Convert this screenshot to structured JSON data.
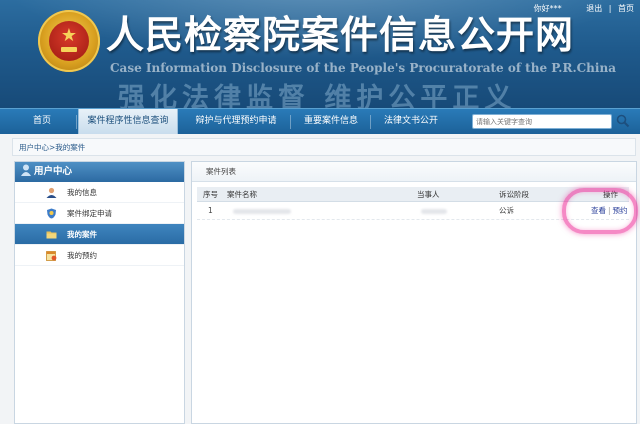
{
  "top_links": {
    "greeting": "你好***",
    "logout": "退出",
    "sep": "|",
    "home": "首页"
  },
  "site": {
    "title": "人民检察院案件信息公开网",
    "subtitle": "Case Information Disclosure of the People's Procuratorate of the P.R.China",
    "slogan": "强化法律监督 维护公平正义"
  },
  "nav": {
    "items": [
      "首页",
      "案件程序性信息查询",
      "辩护与代理预约申请",
      "重要案件信息",
      "法律文书公开"
    ],
    "active_index": 1,
    "search_placeholder": "请输入关键字查询"
  },
  "breadcrumb": "用户中心>我的案件",
  "sidebar": {
    "title": "用户中心",
    "items": [
      {
        "label": "我的信息",
        "icon": "user-icon"
      },
      {
        "label": "案件绑定申请",
        "icon": "shield-icon"
      },
      {
        "label": "我的案件",
        "icon": "folder-icon"
      },
      {
        "label": "我的预约",
        "icon": "calendar-icon"
      }
    ],
    "active_index": 2
  },
  "main": {
    "panel_title": "案件列表",
    "columns": [
      "序号",
      "案件名称",
      "当事人",
      "诉讼阶段",
      "操作"
    ],
    "rows": [
      {
        "index": "1",
        "stage": "公诉",
        "view": "查看",
        "op_sep": "|",
        "reserve": "预约"
      }
    ]
  },
  "colors": {
    "nav_bg": "#1f67a3",
    "sidebar_active": "#2f73ad",
    "highlight": "#ec2896"
  }
}
